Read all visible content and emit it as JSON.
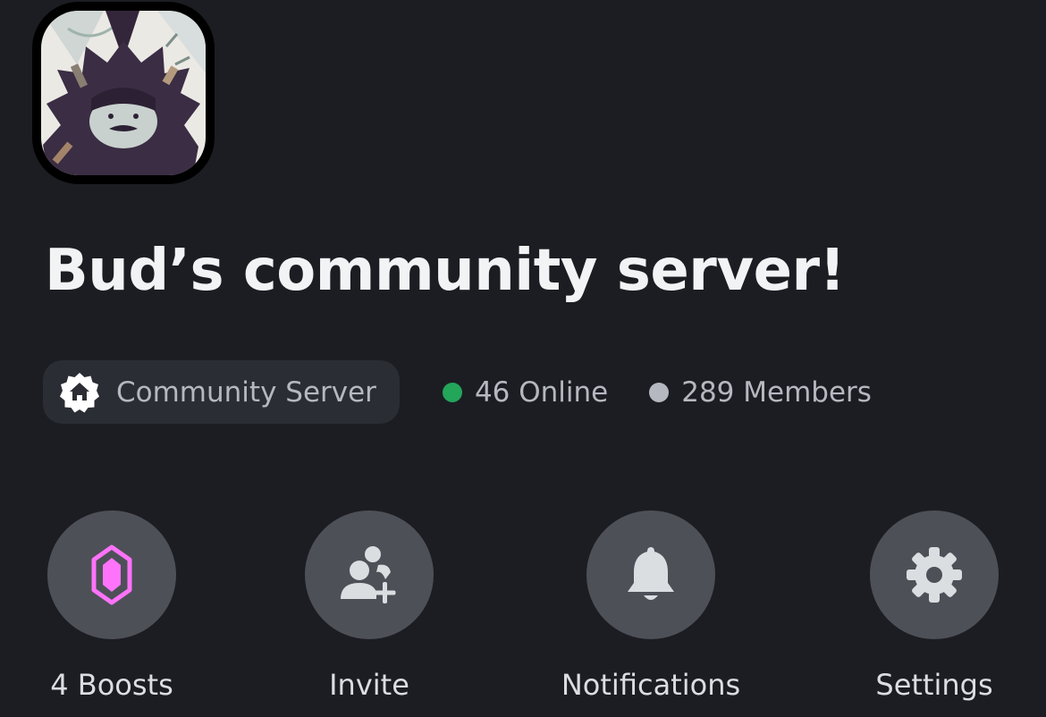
{
  "server": {
    "name": "Bud’s community server!",
    "icon": "server-avatar-icon",
    "type_label": "Community Server",
    "type_icon": "community-house-icon",
    "online": "46 Online",
    "members": "289 Members"
  },
  "colors": {
    "background": "#1c1d22",
    "pill": "#2b2d34",
    "button": "#4e5058",
    "online": "#23a55a",
    "boost": "#ff73fa"
  },
  "actions": [
    {
      "label": "4 Boosts",
      "icon": "boost-gem-icon"
    },
    {
      "label": "Invite",
      "icon": "add-friend-icon"
    },
    {
      "label": "Notifications",
      "icon": "bell-icon"
    },
    {
      "label": "Settings",
      "icon": "gear-icon"
    }
  ]
}
